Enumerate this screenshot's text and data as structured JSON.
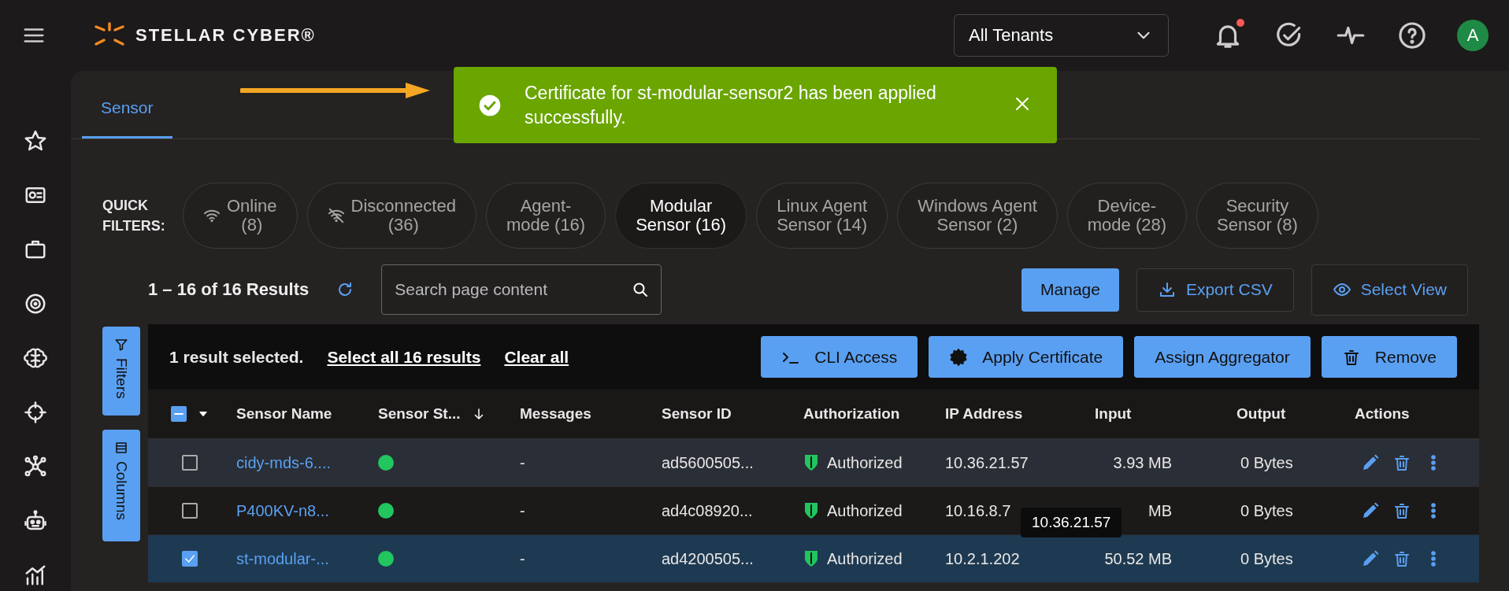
{
  "header": {
    "logo_text": "STELLAR CYBER®",
    "tenant_select": "All Tenants",
    "notifications_unread": true,
    "avatar": "A"
  },
  "tabs": [
    {
      "label": "Sensor",
      "selected": true
    }
  ],
  "toast": {
    "message": "Certificate for st-modular-sensor2 has been applied successfully."
  },
  "quick_filters": {
    "label": "QUICK FILTERS:",
    "items": [
      {
        "lines": [
          "Online",
          "(8)"
        ],
        "kind": "online",
        "selected": false
      },
      {
        "lines": [
          "Disconnected",
          "(36)"
        ],
        "kind": "disconnected",
        "selected": false
      },
      {
        "lines": [
          "Agent-",
          "mode (16)"
        ],
        "kind": "plain",
        "selected": false
      },
      {
        "lines": [
          "Modular",
          "Sensor (16)"
        ],
        "kind": "plain",
        "selected": true
      },
      {
        "lines": [
          "Linux Agent",
          "Sensor (14)"
        ],
        "kind": "plain",
        "selected": false
      },
      {
        "lines": [
          "Windows Agent",
          "Sensor (2)"
        ],
        "kind": "plain",
        "selected": false
      },
      {
        "lines": [
          "Device-",
          "mode (28)"
        ],
        "kind": "plain",
        "selected": false
      },
      {
        "lines": [
          "Security",
          "Sensor (8)"
        ],
        "kind": "plain",
        "selected": false
      }
    ]
  },
  "results": {
    "count": "1 – 16 of 16 Results",
    "search": {
      "placeholder": "Search page content"
    },
    "buttons": [
      {
        "label": "Manage",
        "kind": "primary"
      },
      {
        "label": "Export CSV",
        "kind": "export"
      },
      {
        "label": "Select View",
        "kind": "view"
      }
    ]
  },
  "side_tabs": [
    {
      "label": "Filters",
      "kind": "filters"
    },
    {
      "label": "Columns",
      "kind": "columns"
    }
  ],
  "selection": {
    "text": "1 result selected.",
    "links": [
      "Select all 16 results",
      "Clear all"
    ],
    "actions": [
      {
        "label": "CLI Access",
        "kind": "cli"
      },
      {
        "label": "Apply Certificate",
        "kind": "certificate"
      },
      {
        "label": "Assign Aggregator",
        "kind": "plain"
      },
      {
        "label": "Remove",
        "kind": "delete"
      }
    ]
  },
  "table": {
    "select_all_indeterminate": true,
    "columns": [
      {
        "label": "Sensor Name",
        "sorted": false
      },
      {
        "label": "Sensor St...",
        "sorted": true
      },
      {
        "label": "Messages",
        "sorted": false
      },
      {
        "label": "Sensor ID",
        "sorted": false
      },
      {
        "label": "Authorization",
        "sorted": false
      },
      {
        "label": "IP Address",
        "sorted": false
      },
      {
        "label": "Input",
        "sorted": false
      },
      {
        "label": "Output",
        "sorted": false
      },
      {
        "label": "Actions",
        "sorted": false
      }
    ],
    "rows": [
      {
        "selected": false,
        "highlighted": true,
        "name": "cidy-mds-6....",
        "color": "#22c55e",
        "messages": "-",
        "sensor_id": "ad5600505...",
        "authorization": "Authorized",
        "ip": "10.36.21.57",
        "input": "3.93 MB",
        "output": "0 Bytes"
      },
      {
        "selected": false,
        "highlighted": false,
        "name": "P400KV-n8...",
        "color": "#22c55e",
        "messages": "-",
        "sensor_id": "ad4c08920...",
        "authorization": "Authorized",
        "ip": "10.16.8.7",
        "input": "MB",
        "output": "0 Bytes"
      },
      {
        "selected": true,
        "highlighted": false,
        "name": "st-modular-...",
        "color": "#22c55e",
        "messages": "-",
        "sensor_id": "ad4200505...",
        "authorization": "Authorized",
        "ip": "10.2.1.202",
        "input": "50.52 MB",
        "output": "0 Bytes"
      }
    ]
  },
  "tooltip": "10.36.21.57"
}
